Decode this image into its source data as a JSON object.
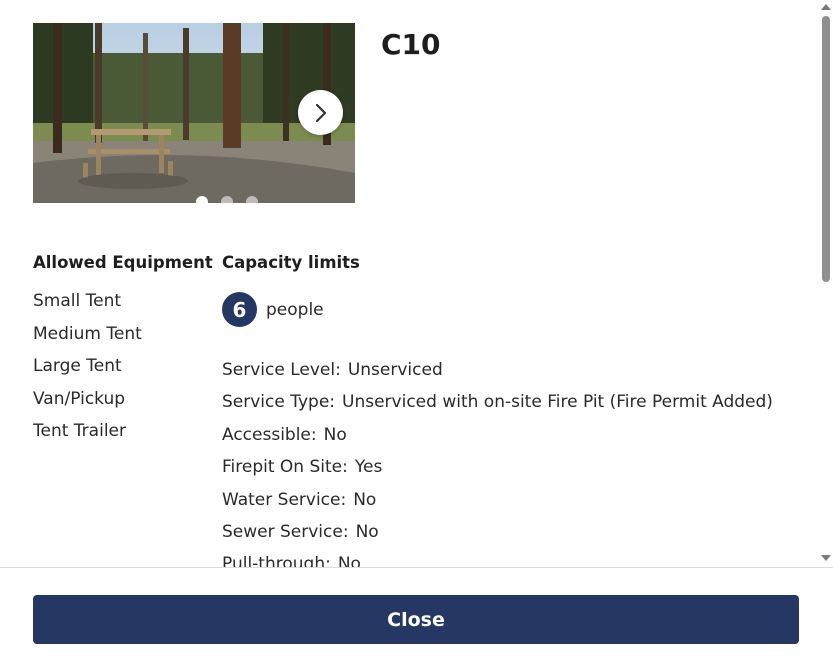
{
  "site": {
    "title": "C10"
  },
  "carousel": {
    "image_alt": "Campsite photo: picnic table among pine trees",
    "next_icon": "chevron-right-icon",
    "slide_count": 3,
    "active_slide": 1
  },
  "equipment": {
    "heading": "Allowed Equipment",
    "items": [
      "Small Tent",
      "Medium Tent",
      "Large Tent",
      "Van/Pickup",
      "Tent Trailer"
    ]
  },
  "capacity": {
    "heading": "Capacity limits",
    "people_count": "6",
    "people_unit": "people"
  },
  "attributes": [
    {
      "label": "Service Level:",
      "value": "Unserviced"
    },
    {
      "label": "Service Type:",
      "value": "Unserviced with on-site Fire Pit (Fire Permit Added)"
    },
    {
      "label": "Accessible:",
      "value": "No"
    },
    {
      "label": "Firepit On Site:",
      "value": "Yes"
    },
    {
      "label": "Water Service:",
      "value": "No"
    },
    {
      "label": "Sewer Service:",
      "value": "No"
    },
    {
      "label": "Pull-through:",
      "value": "No"
    }
  ],
  "footer": {
    "close_label": "Close"
  },
  "colors": {
    "primary": "#243863",
    "text": "#1e1e1e",
    "divider": "#dcdcdc"
  }
}
